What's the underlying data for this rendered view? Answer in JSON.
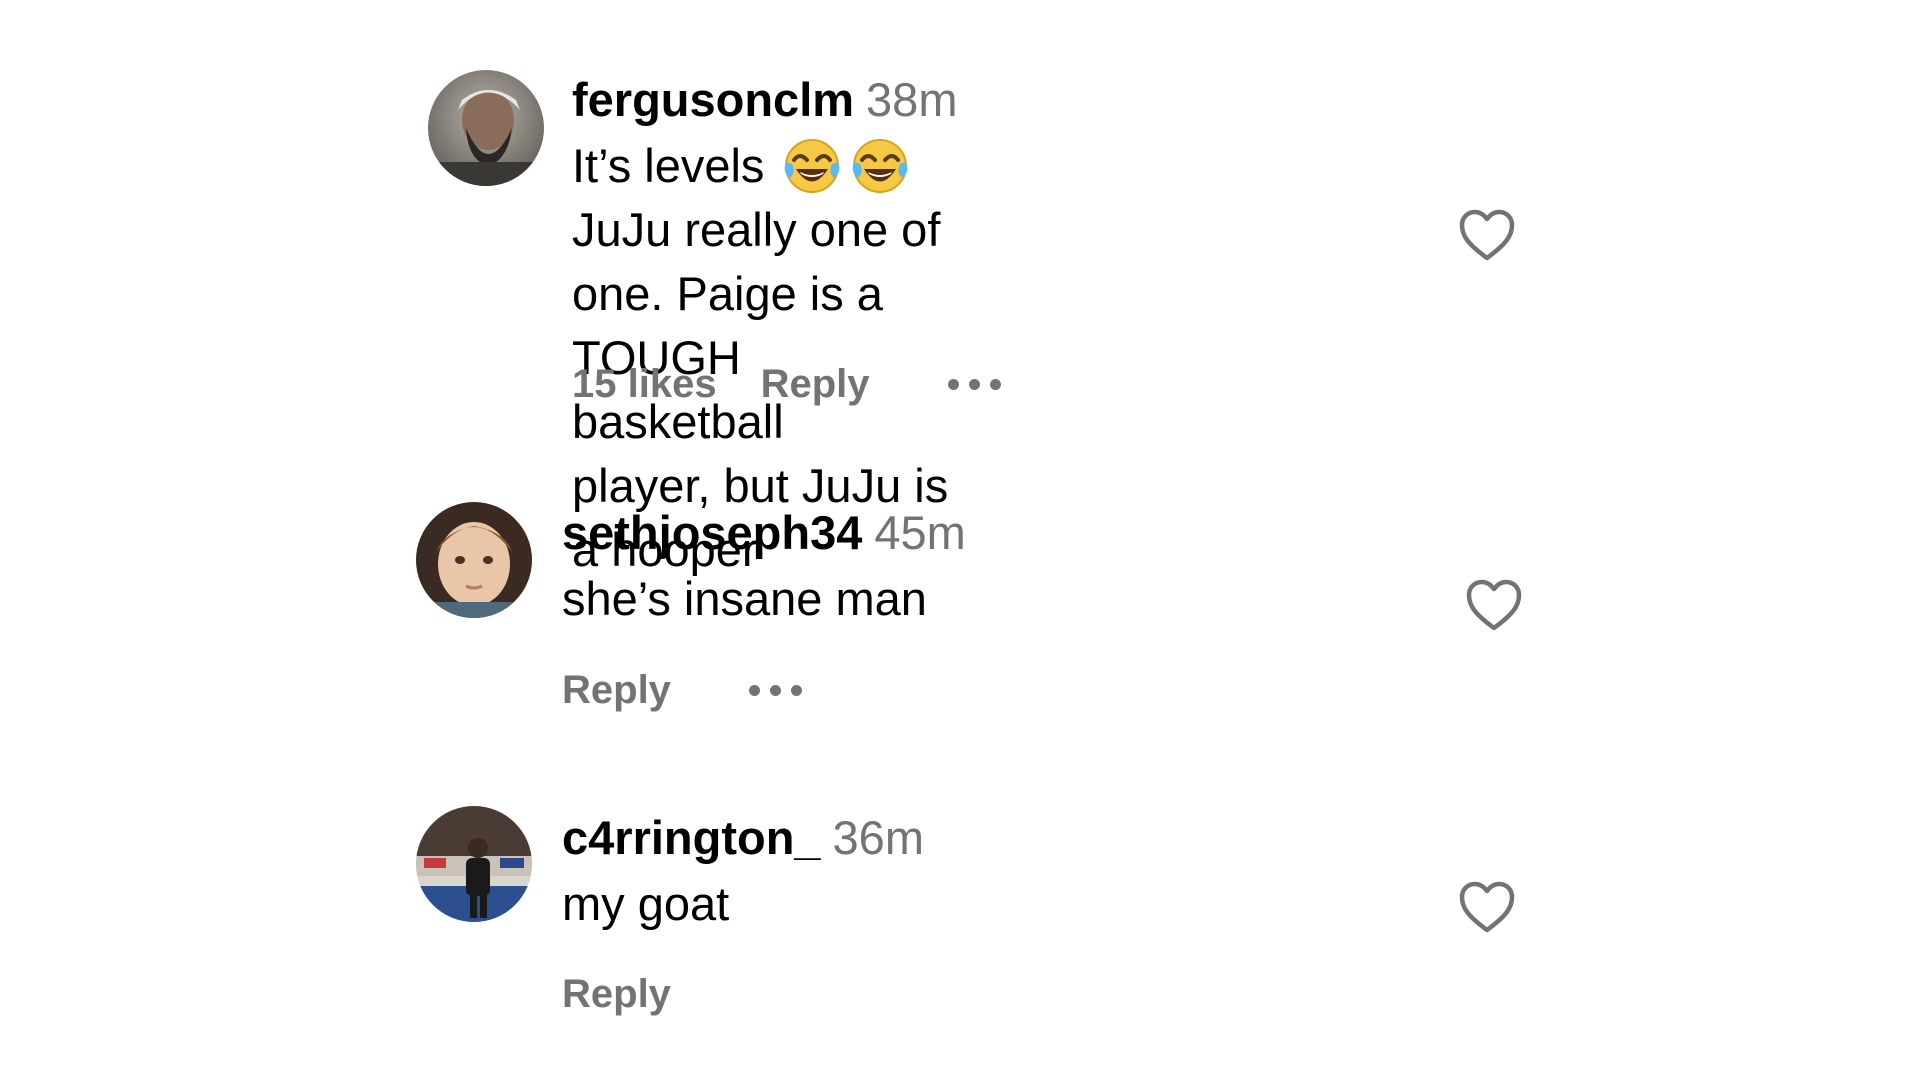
{
  "comments": [
    {
      "username": "fergusonclm",
      "time": "38m",
      "text_before": "It’s levels",
      "emoji": [
        "😂",
        "😂"
      ],
      "emoji_name": "face-with-tears-of-joy-icon",
      "line1_after": "JuJu really one of",
      "line2": "one. Paige is a TOUGH basketball",
      "line3": "player, but JuJu is a hooper",
      "likes": "15 likes",
      "reply": "Reply",
      "more_icon": "ellipsis-icon",
      "like_icon": "heart-outline-icon"
    },
    {
      "username": "sethjoseph34",
      "time": "45m",
      "text": "she’s insane man",
      "reply": "Reply",
      "more_icon": "ellipsis-icon",
      "like_icon": "heart-outline-icon"
    },
    {
      "username": "c4rrington_",
      "time": "36m",
      "text": "my goat",
      "reply": "Reply",
      "like_icon": "heart-outline-icon"
    }
  ],
  "colors": {
    "primary_text": "#000000",
    "secondary_text": "#737373",
    "heart_stroke": "#737373",
    "background": "#ffffff"
  }
}
